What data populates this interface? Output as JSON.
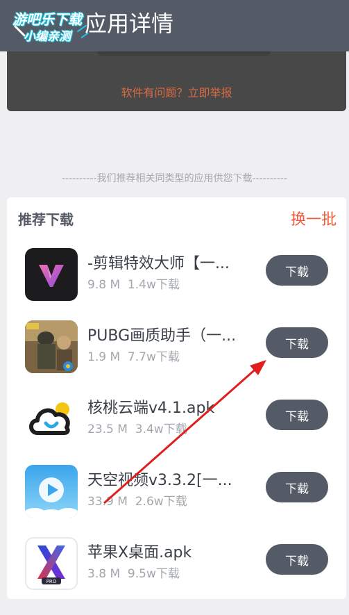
{
  "header": {
    "title": "应用详情",
    "watermark_line1": "游吧乐下载",
    "watermark_line2": "小编亲测"
  },
  "report": {
    "link_text": "软件有问题？立即举报"
  },
  "recommend_hint": "----------我们推荐相关同类型的应用供您下载----------",
  "recommend": {
    "title": "推荐下载",
    "refresh_label": "换一批",
    "apps": [
      {
        "name": "-剪辑特效大师【一...",
        "size": "9.8 M",
        "downloads": "1.4w下载",
        "button": "下载",
        "icon": "video-editor-icon"
      },
      {
        "name": "PUBG画质助手（一...",
        "size": "1.9 M",
        "downloads": "7.7w下载",
        "button": "下载",
        "icon": "pubg-icon"
      },
      {
        "name": "核桃云端v4.1.apk",
        "size": "23.5 M",
        "downloads": "3.4w下载",
        "button": "下载",
        "icon": "cloud-icon"
      },
      {
        "name": "天空视频v3.3.2[一...",
        "size": "33.9 M",
        "downloads": "2.6w下载",
        "button": "下载",
        "icon": "sky-video-icon"
      },
      {
        "name": "苹果X桌面.apk",
        "size": "3.8 M",
        "downloads": "9.5w下载",
        "button": "下载",
        "icon": "x-launcher-icon"
      }
    ]
  },
  "colors": {
    "header_bg": "#555b66",
    "accent_red": "#f05a3c",
    "report_text": "#d86b44",
    "button_bg": "#555b66"
  }
}
